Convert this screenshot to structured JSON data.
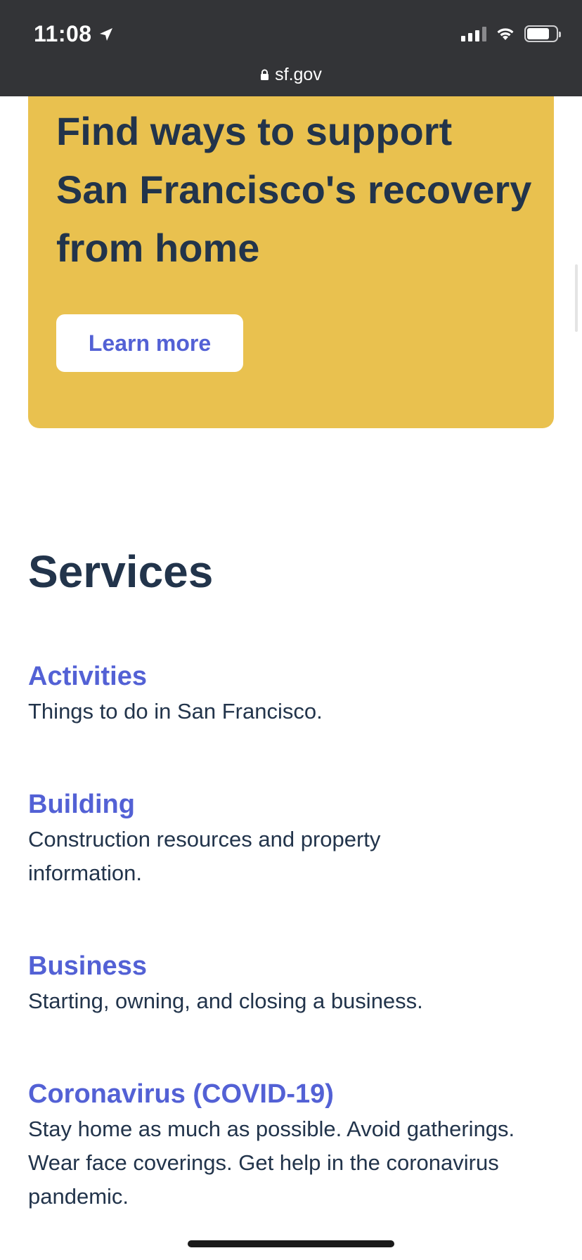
{
  "status_bar": {
    "time": "11:08",
    "url": "sf.gov"
  },
  "hero": {
    "title": "Find ways to support San Francisco's recovery from home",
    "button_label": "Learn more"
  },
  "services": {
    "heading": "Services",
    "items": [
      {
        "title": "Activities",
        "description": "Things to do in San Francisco."
      },
      {
        "title": "Building",
        "description": "Construction resources and property information."
      },
      {
        "title": "Business",
        "description": "Starting, owning, and closing a business."
      },
      {
        "title": "Coronavirus (COVID-19)",
        "description": "Stay home as much as possible. Avoid gatherings. Wear face coverings. Get help in the coronavirus pandemic."
      }
    ]
  },
  "colors": {
    "hero_background": "#e9c14f",
    "heading": "#22344b",
    "link": "#5361d5",
    "status_bar": "#333437"
  }
}
